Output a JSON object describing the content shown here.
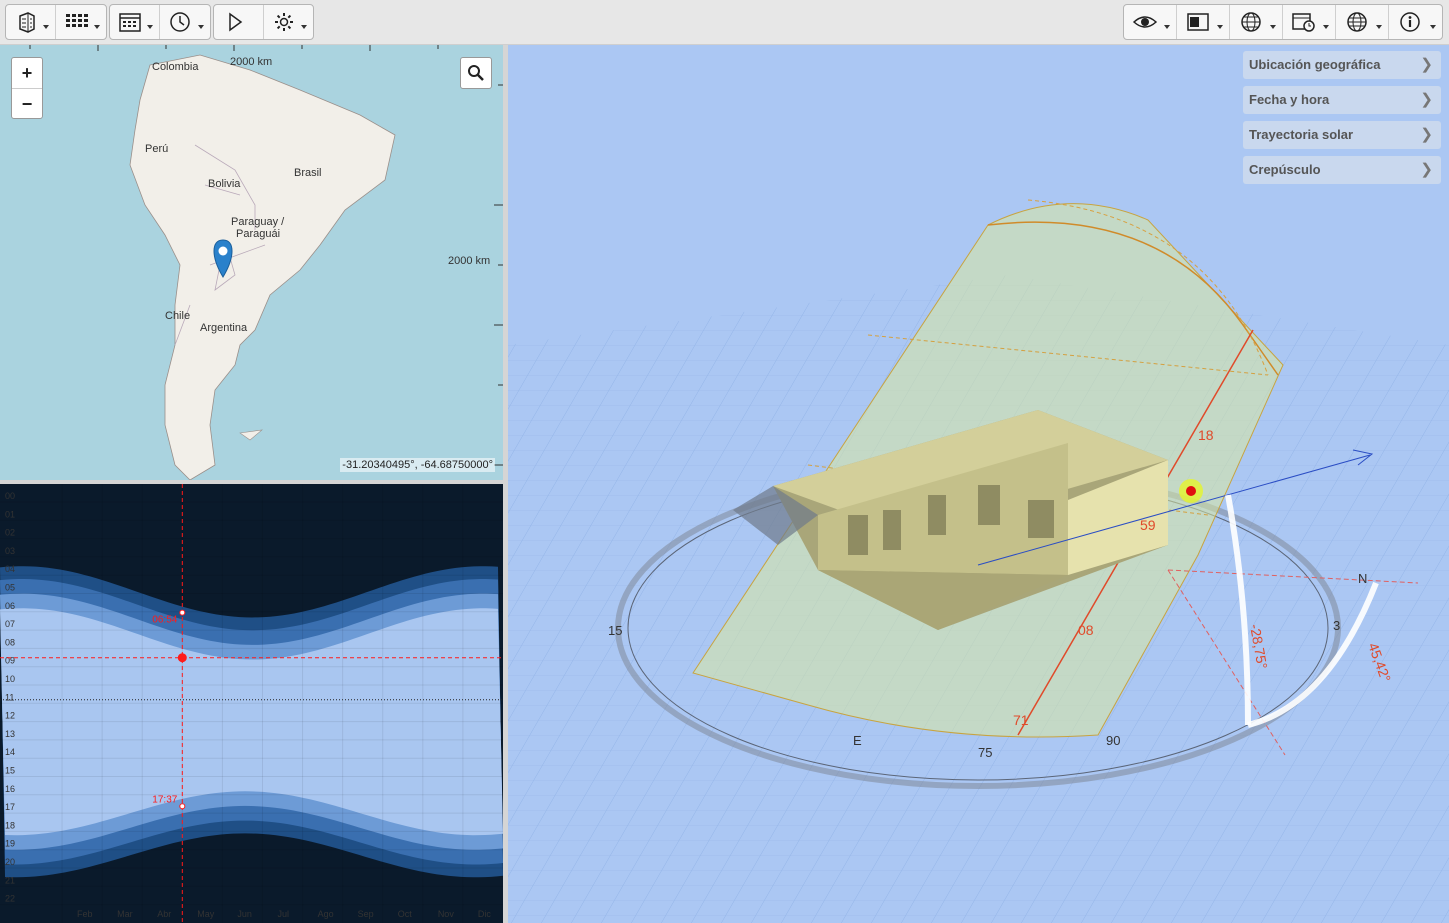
{
  "toolbar": {
    "left_groups": [
      [
        "building-icon",
        "grid-icon"
      ],
      [
        "calendar-icon",
        "clock-icon"
      ],
      [
        "play-icon",
        "gear-icon"
      ]
    ],
    "right_group": [
      "eye-icon",
      "window-icon",
      "sphere-grid-icon",
      "calendar-clock-icon",
      "globe-icon",
      "info-icon"
    ]
  },
  "map": {
    "zoom_in": "+",
    "zoom_out": "−",
    "scale_top": "2000 km",
    "scale_right": "2000 km",
    "coords": "-31.20340495°, -64.68750000°",
    "labels": {
      "colombia": "Colombia",
      "peru": "Perú",
      "brasil": "Brasil",
      "bolivia": "Bolivia",
      "paraguay1": "Paraguay /",
      "paraguay2": "Paraguái",
      "chile": "Chile",
      "argentina": "Argentina"
    }
  },
  "chart_data": {
    "type": "area",
    "title": "",
    "y_ticks": [
      "00",
      "01",
      "02",
      "03",
      "04",
      "05",
      "06",
      "07",
      "08",
      "09",
      "10",
      "11",
      "12",
      "13",
      "14",
      "15",
      "16",
      "17",
      "18",
      "19",
      "20",
      "21",
      "22"
    ],
    "x_ticks": [
      "Feb",
      "Mar",
      "Abr",
      "May",
      "Jun",
      "Jul",
      "Ago",
      "Sep",
      "Oct",
      "Nov",
      "Dic"
    ],
    "selected_sunrise": "06:54",
    "selected_sunset": "17:37",
    "selected_date": "May",
    "selected_hour": 9,
    "colors": {
      "night": "#0a1a2b",
      "day": "#a9c6f0",
      "twilight1": "#1f4f86",
      "twilight2": "#3a6fb0",
      "twilight3": "#6d9bd6",
      "marker": "#ff1a1a"
    }
  },
  "view": {
    "panels": [
      "Ubicación geográfica",
      "Fecha y hora",
      "Trayectoria solar",
      "Crepúsculo"
    ],
    "annotations": {
      "alt": "-28,75°",
      "az": "45,42°",
      "north": "N",
      "compass_15": "15",
      "compass_3": "3",
      "compass_e": "E",
      "compass_75": "75",
      "compass_90": "90",
      "hour_81": "18",
      "hour_65": "59",
      "hour_80": "08",
      "hour_71": "71"
    }
  }
}
